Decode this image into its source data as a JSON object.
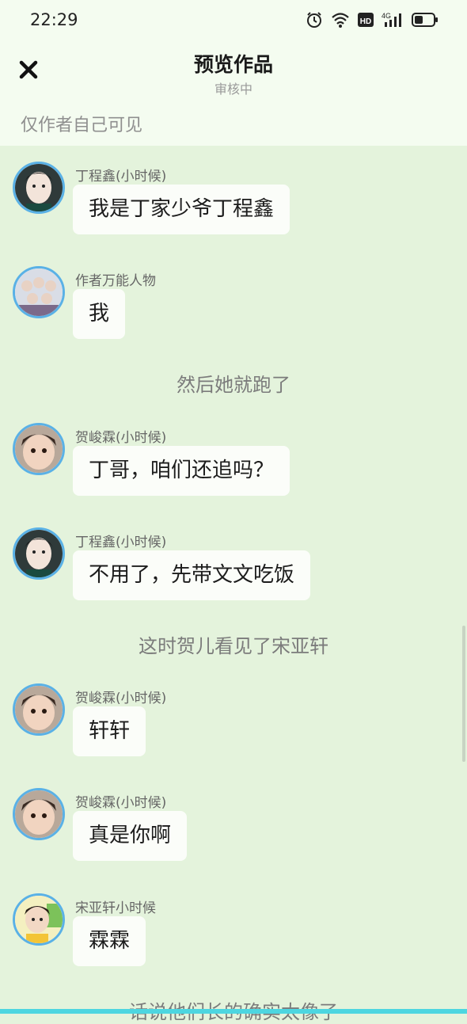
{
  "status_bar": {
    "time": "22:29",
    "icons": [
      "alarm-icon",
      "wifi-icon",
      "hd-icon",
      "signal-4g-icon",
      "battery-icon"
    ],
    "network_label": "4G",
    "hd_label": "HD"
  },
  "header": {
    "close_icon": "close-icon",
    "title": "预览作品",
    "subtitle": "审核中",
    "visibility_note": "仅作者自己可见"
  },
  "messages": [
    {
      "type": "chat",
      "sender": "丁程鑫(小时候)",
      "text": "我是丁家少爷丁程鑫",
      "avatar": "avatar-ding"
    },
    {
      "type": "chat",
      "sender": "作者万能人物",
      "text": "我",
      "avatar": "avatar-author"
    },
    {
      "type": "narration",
      "text": "然后她就跑了"
    },
    {
      "type": "chat",
      "sender": "贺峻霖(小时候)",
      "text": "丁哥，咱们还追吗？",
      "avatar": "avatar-he"
    },
    {
      "type": "chat",
      "sender": "丁程鑫(小时候)",
      "text": "不用了，先带文文吃饭",
      "avatar": "avatar-ding"
    },
    {
      "type": "narration",
      "text": "这时贺儿看见了宋亚轩"
    },
    {
      "type": "chat",
      "sender": "贺峻霖(小时候)",
      "text": "轩轩",
      "avatar": "avatar-he"
    },
    {
      "type": "chat",
      "sender": "贺峻霖(小时候)",
      "text": "真是你啊",
      "avatar": "avatar-he"
    },
    {
      "type": "chat",
      "sender": "宋亚轩小时候",
      "text": "霖霖",
      "avatar": "avatar-song"
    },
    {
      "type": "narration",
      "text": "话说他们长的确实太像了"
    }
  ],
  "colors": {
    "background": "#e4f3dc",
    "header_background": "#f4fcf0",
    "bubble": "#fbfdf9",
    "avatar_ring": "#5ab1e6",
    "bottom_accent": "#4dd6e0"
  }
}
